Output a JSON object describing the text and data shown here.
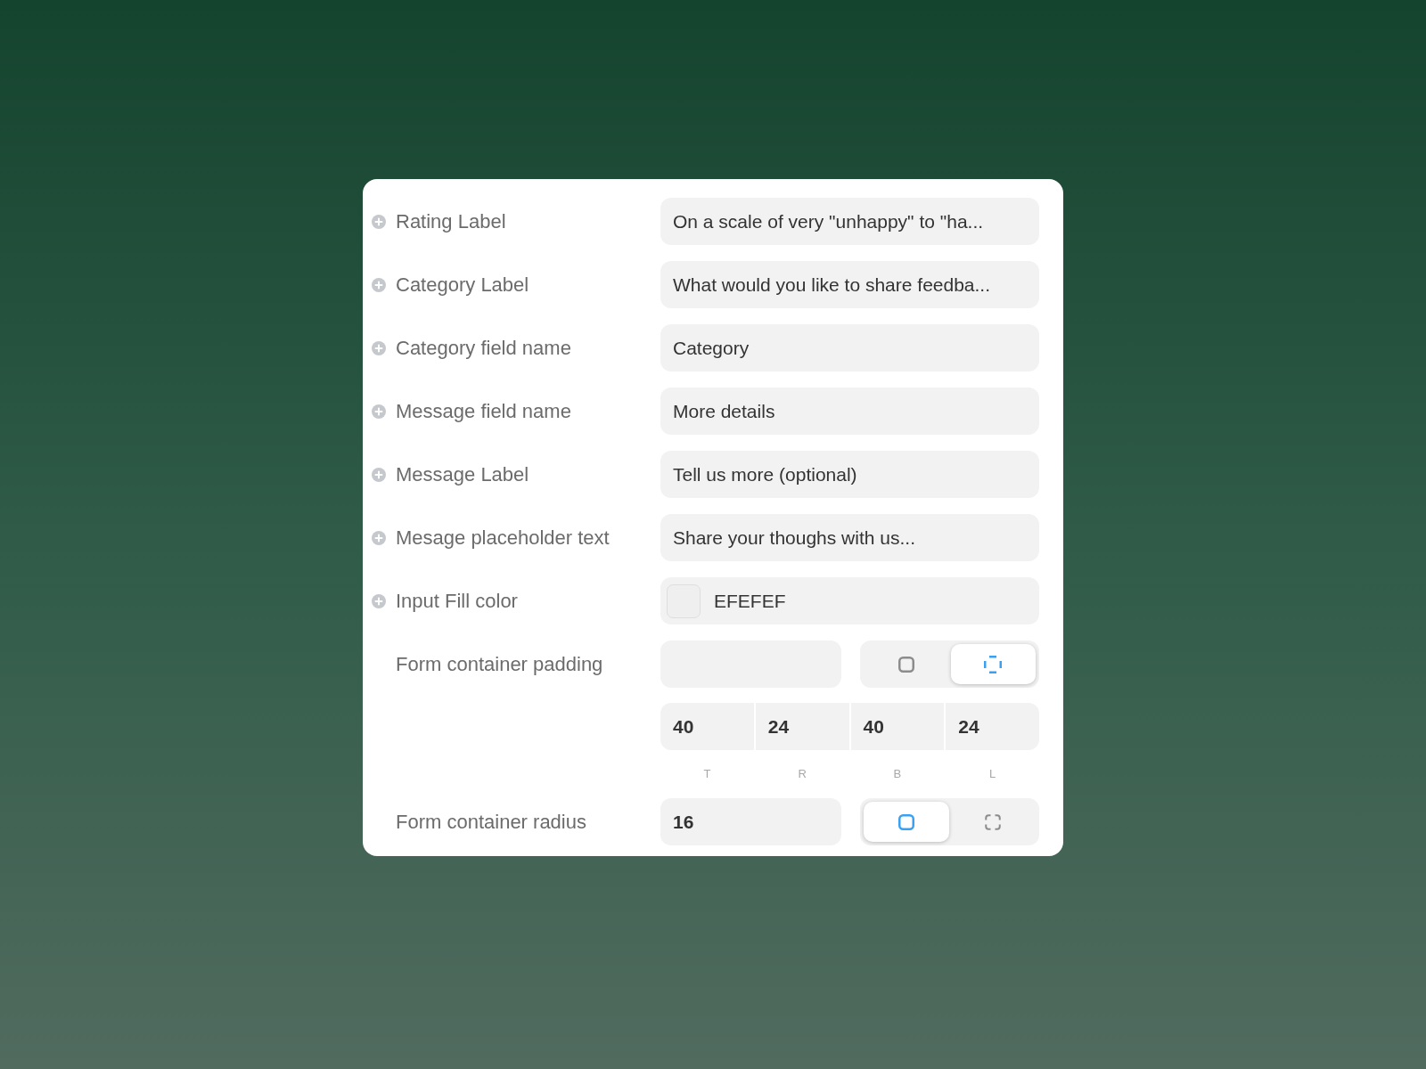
{
  "form": {
    "properties": [
      {
        "kind": "text",
        "label": "Rating Label",
        "value": "On a scale of very \"unhappy\" to \"ha..."
      },
      {
        "kind": "text",
        "label": "Category Label",
        "value": "What would you like to share feedba..."
      },
      {
        "kind": "text",
        "label": "Category field name",
        "value": "Category"
      },
      {
        "kind": "text",
        "label": "Message field name",
        "value": "More details"
      },
      {
        "kind": "text",
        "label": "Message Label",
        "value": "Tell us more (optional)"
      },
      {
        "kind": "text",
        "label": "Mesage placeholder text",
        "value": "Share your thoughs with us..."
      },
      {
        "kind": "color",
        "label": "Input Fill color",
        "value": "EFEFEF",
        "color": "#efefef"
      }
    ],
    "padding": {
      "label": "Form container padding",
      "modes": [
        {
          "kind": "uniform",
          "selected": false
        },
        {
          "kind": "sides",
          "selected": true
        }
      ],
      "sides": [
        {
          "value": "40",
          "caption": "T"
        },
        {
          "value": "24",
          "caption": "R"
        },
        {
          "value": "40",
          "caption": "B"
        },
        {
          "value": "24",
          "caption": "L"
        }
      ]
    },
    "radius": {
      "label": "Form container radius",
      "value": "16",
      "modes": [
        {
          "kind": "uniform",
          "selected": true
        },
        {
          "kind": "corners",
          "selected": false
        }
      ]
    }
  }
}
